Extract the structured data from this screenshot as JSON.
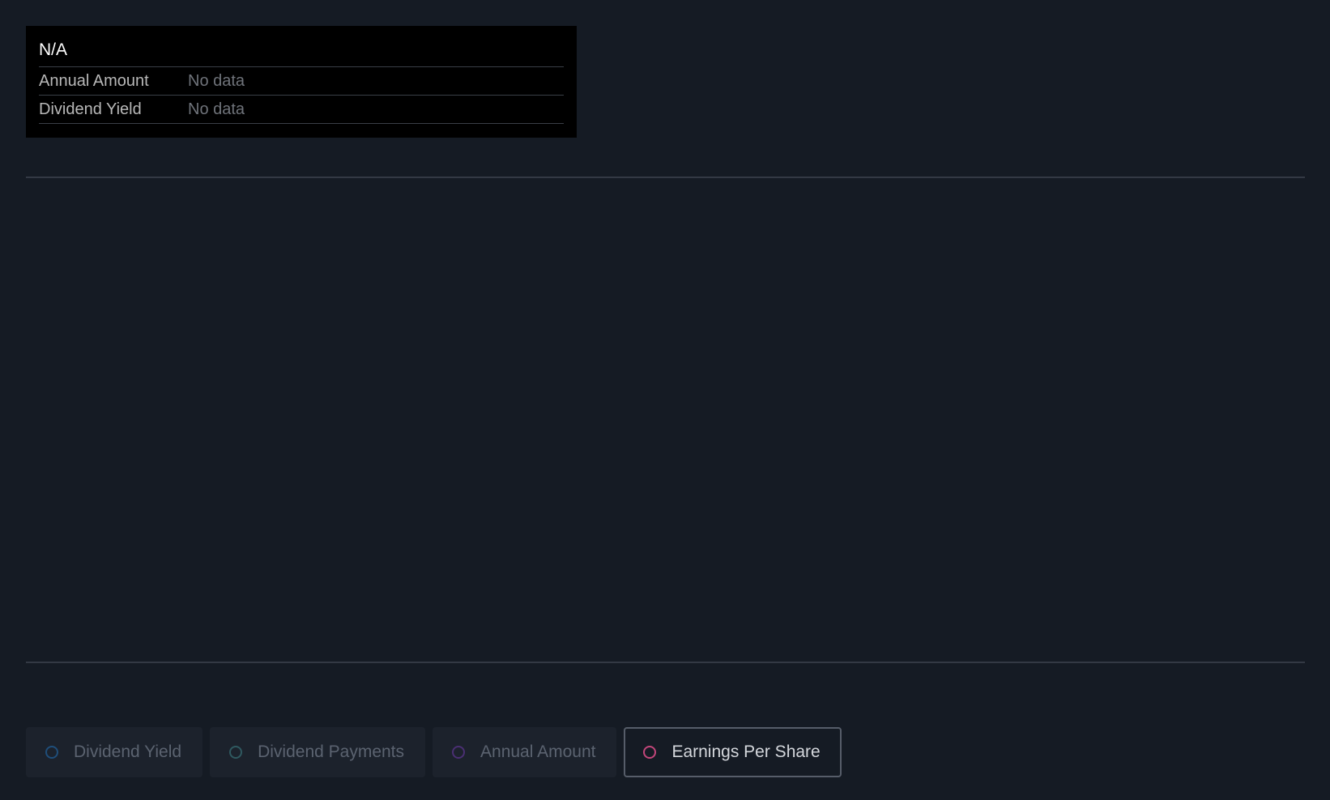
{
  "tooltip": {
    "title": "N/A",
    "rows": [
      {
        "label": "Annual Amount",
        "value": "No data"
      },
      {
        "label": "Dividend Yield",
        "value": "No data"
      }
    ]
  },
  "legend": {
    "items": [
      {
        "label": "Dividend Yield",
        "color": "#1f4e7a",
        "active": false
      },
      {
        "label": "Dividend Payments",
        "color": "#2f5960",
        "active": false
      },
      {
        "label": "Annual Amount",
        "color": "#4a2f73",
        "active": false
      },
      {
        "label": "Earnings Per Share",
        "color": "#c2467a",
        "active": true
      }
    ]
  }
}
